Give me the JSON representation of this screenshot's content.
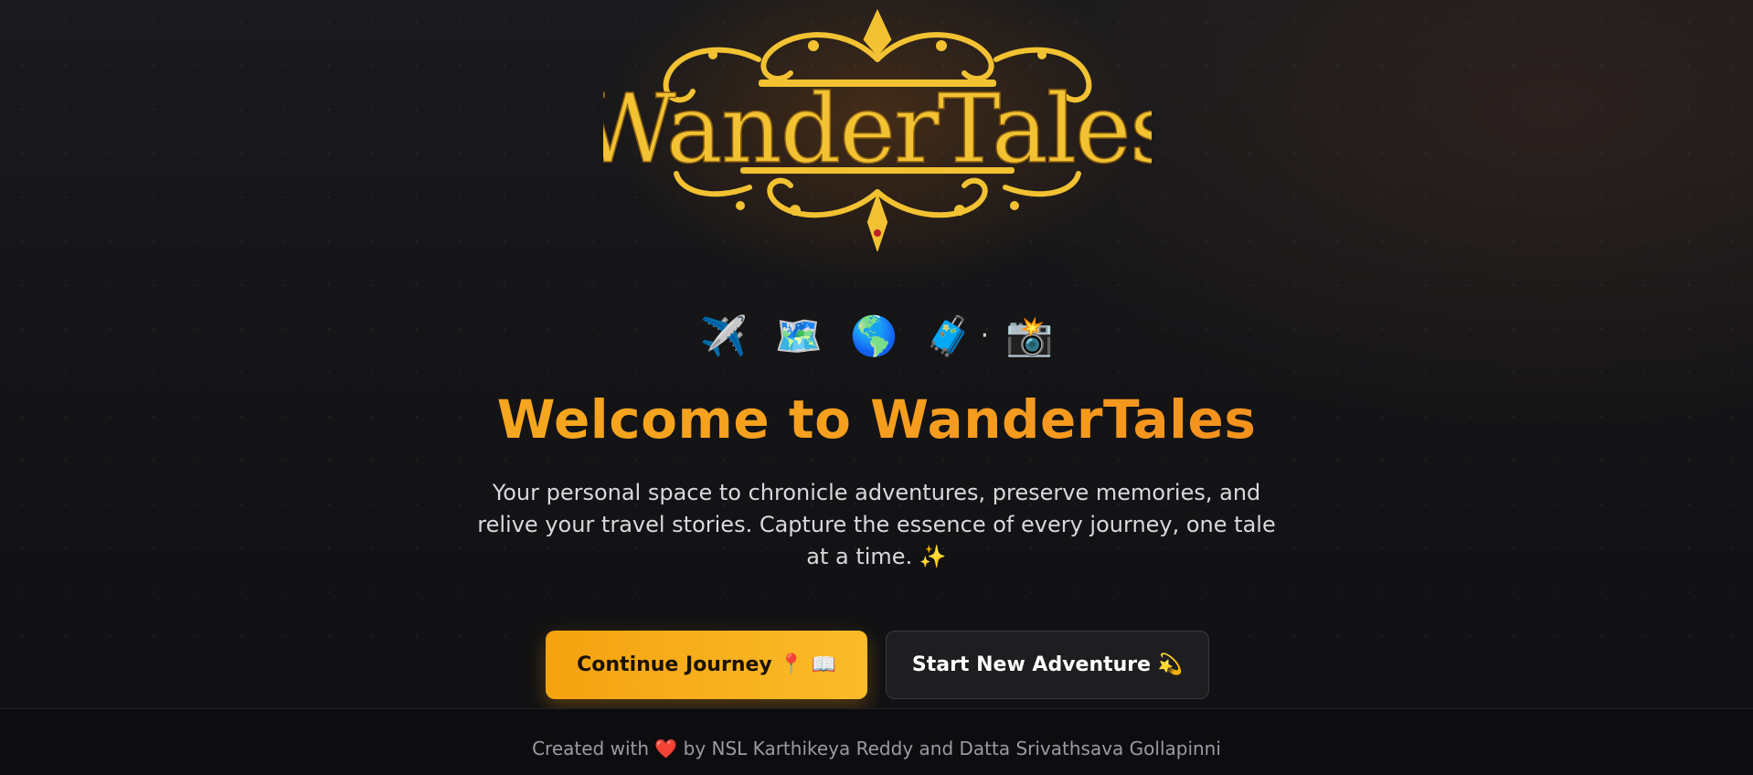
{
  "logo": {
    "text": "WanderTales",
    "brand_color": "#f2c232"
  },
  "emoji_row": [
    "✈️",
    "🗺️",
    "🌎",
    "🧳",
    "·",
    "📸"
  ],
  "hero": {
    "title": "Welcome to WanderTales",
    "subtitle": "Your personal space to chronicle adventures, preserve memories, and relive your travel stories. Capture the essence of every journey, one tale at a time. ✨"
  },
  "buttons": {
    "continue_label": "Continue Journey 📍 📖",
    "new_label": "Start New Adventure 💫"
  },
  "footer": {
    "text": "Created with ❤️ by NSL Karthikeya Reddy and Datta Srivathsava Gollapinni"
  },
  "colors": {
    "accent": "#f5a20f",
    "title_gradient_start": "#f6b21f",
    "title_gradient_end": "#f27f1b",
    "background": "#141416"
  }
}
